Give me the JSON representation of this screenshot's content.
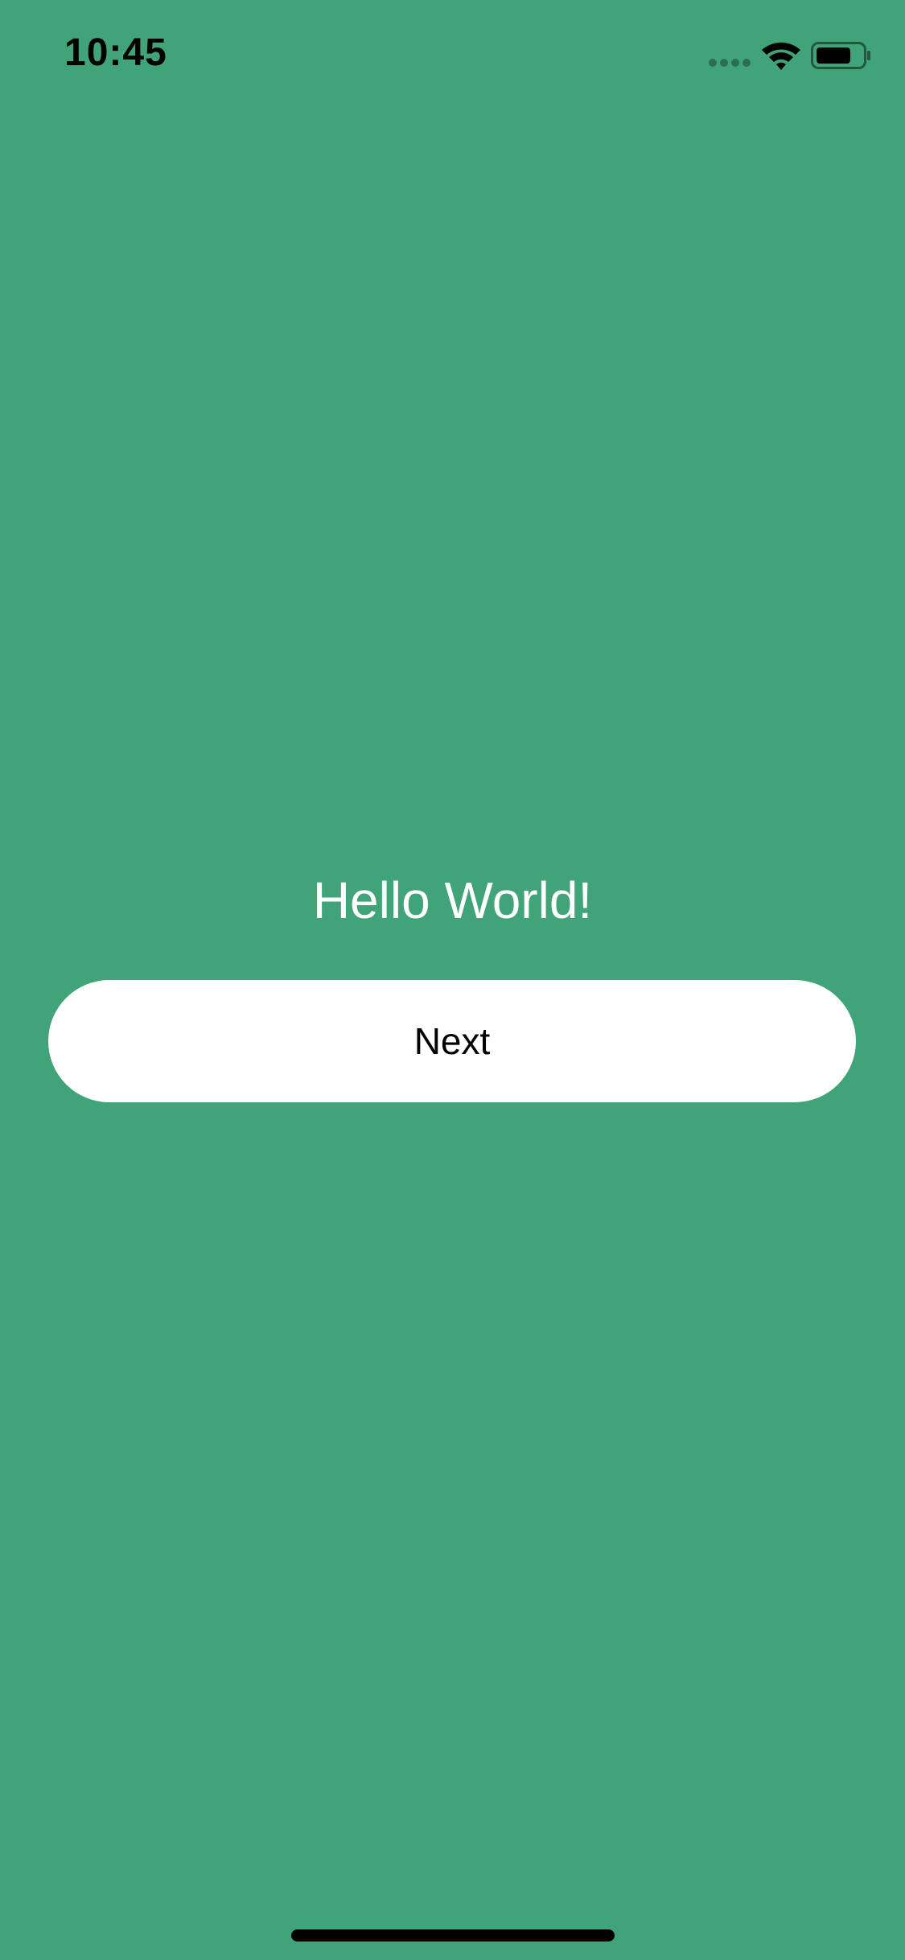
{
  "status_bar": {
    "time": "10:45",
    "icons": [
      "cellular-signal-icon",
      "wifi-icon",
      "battery-icon"
    ]
  },
  "main": {
    "greeting": "Hello World!",
    "next_button_label": "Next"
  },
  "colors": {
    "background": "#41a478",
    "button_background": "#ffffff",
    "greeting_text": "#ffffff",
    "button_text": "#000000",
    "status_text": "#000000"
  }
}
